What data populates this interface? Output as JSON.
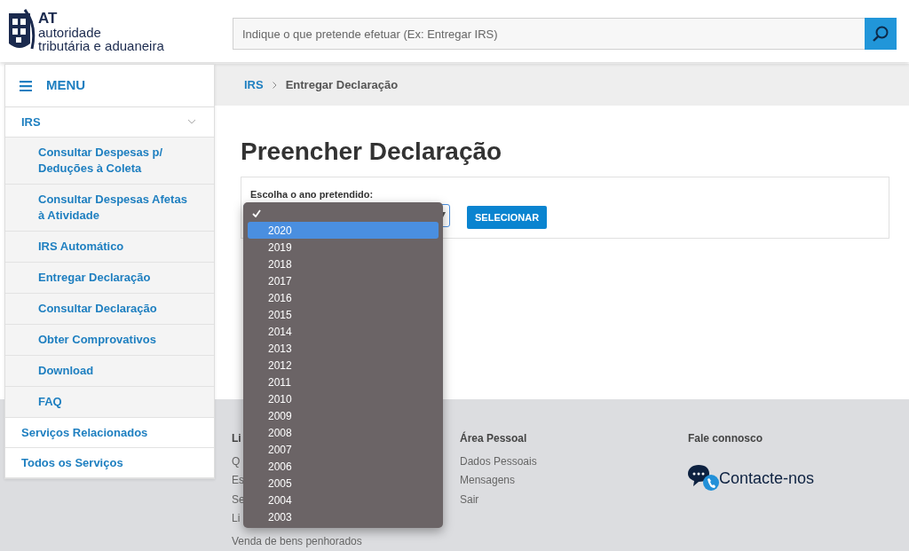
{
  "header": {
    "logo": {
      "acronym": "AT",
      "line1": "autoridade",
      "line2": "tributária e aduaneira"
    },
    "search": {
      "placeholder": "Indique o que pretende efetuar (Ex: Entregar IRS)"
    }
  },
  "sidebar": {
    "menu_label": "MENU",
    "items": [
      {
        "label": "IRS",
        "expanded": true,
        "children": [
          {
            "label": "Consultar Despesas p/ Deduções à Coleta"
          },
          {
            "label": "Consultar Despesas Afetas à Atividade"
          },
          {
            "label": "IRS Automático"
          },
          {
            "label": "Entregar Declaração"
          },
          {
            "label": "Consultar Declaração"
          },
          {
            "label": "Obter Comprovativos"
          },
          {
            "label": "Download"
          },
          {
            "label": "FAQ"
          }
        ]
      },
      {
        "label": "Serviços Relacionados"
      },
      {
        "label": "Todos os Serviços"
      }
    ]
  },
  "breadcrumb": [
    "IRS",
    "Entregar Declaração"
  ],
  "title": "Preencher Declaração",
  "form": {
    "label": "Escolha o ano pretendido:",
    "button": "SELECIONAR",
    "options": [
      {
        "checked": true,
        "selected": false
      },
      {
        "label": "2020",
        "checked": false,
        "selected": true
      },
      {
        "label": "2019",
        "checked": false,
        "selected": false
      },
      {
        "label": "2018",
        "checked": false,
        "selected": false
      },
      {
        "label": "2017",
        "checked": false,
        "selected": false
      },
      {
        "label": "2016",
        "checked": false,
        "selected": false
      },
      {
        "label": "2015",
        "checked": false,
        "selected": false
      },
      {
        "label": "2014",
        "checked": false,
        "selected": false
      },
      {
        "label": "2013",
        "checked": false,
        "selected": false
      },
      {
        "label": "2012",
        "checked": false,
        "selected": false
      },
      {
        "label": "2011",
        "checked": false,
        "selected": false
      },
      {
        "label": "2010",
        "checked": false,
        "selected": false
      },
      {
        "label": "2009",
        "checked": false,
        "selected": false
      },
      {
        "label": "2008",
        "checked": false,
        "selected": false
      },
      {
        "label": "2007",
        "checked": false,
        "selected": false
      },
      {
        "label": "2006",
        "checked": false,
        "selected": false
      },
      {
        "label": "2005",
        "checked": false,
        "selected": false
      },
      {
        "label": "2004",
        "checked": false,
        "selected": false
      },
      {
        "label": "2003",
        "checked": false,
        "selected": false
      }
    ]
  },
  "footer": {
    "columns": [
      {
        "title": "Li",
        "links": [
          "Q",
          "Es",
          "Se",
          "Li",
          "Venda de bens penhorados"
        ]
      },
      {
        "title": "Área Pessoal",
        "links": [
          "Dados Pessoais",
          "Mensagens",
          "Sair"
        ]
      },
      {
        "title": "Fale connosco",
        "contact": "Contacte-nos"
      }
    ]
  }
}
